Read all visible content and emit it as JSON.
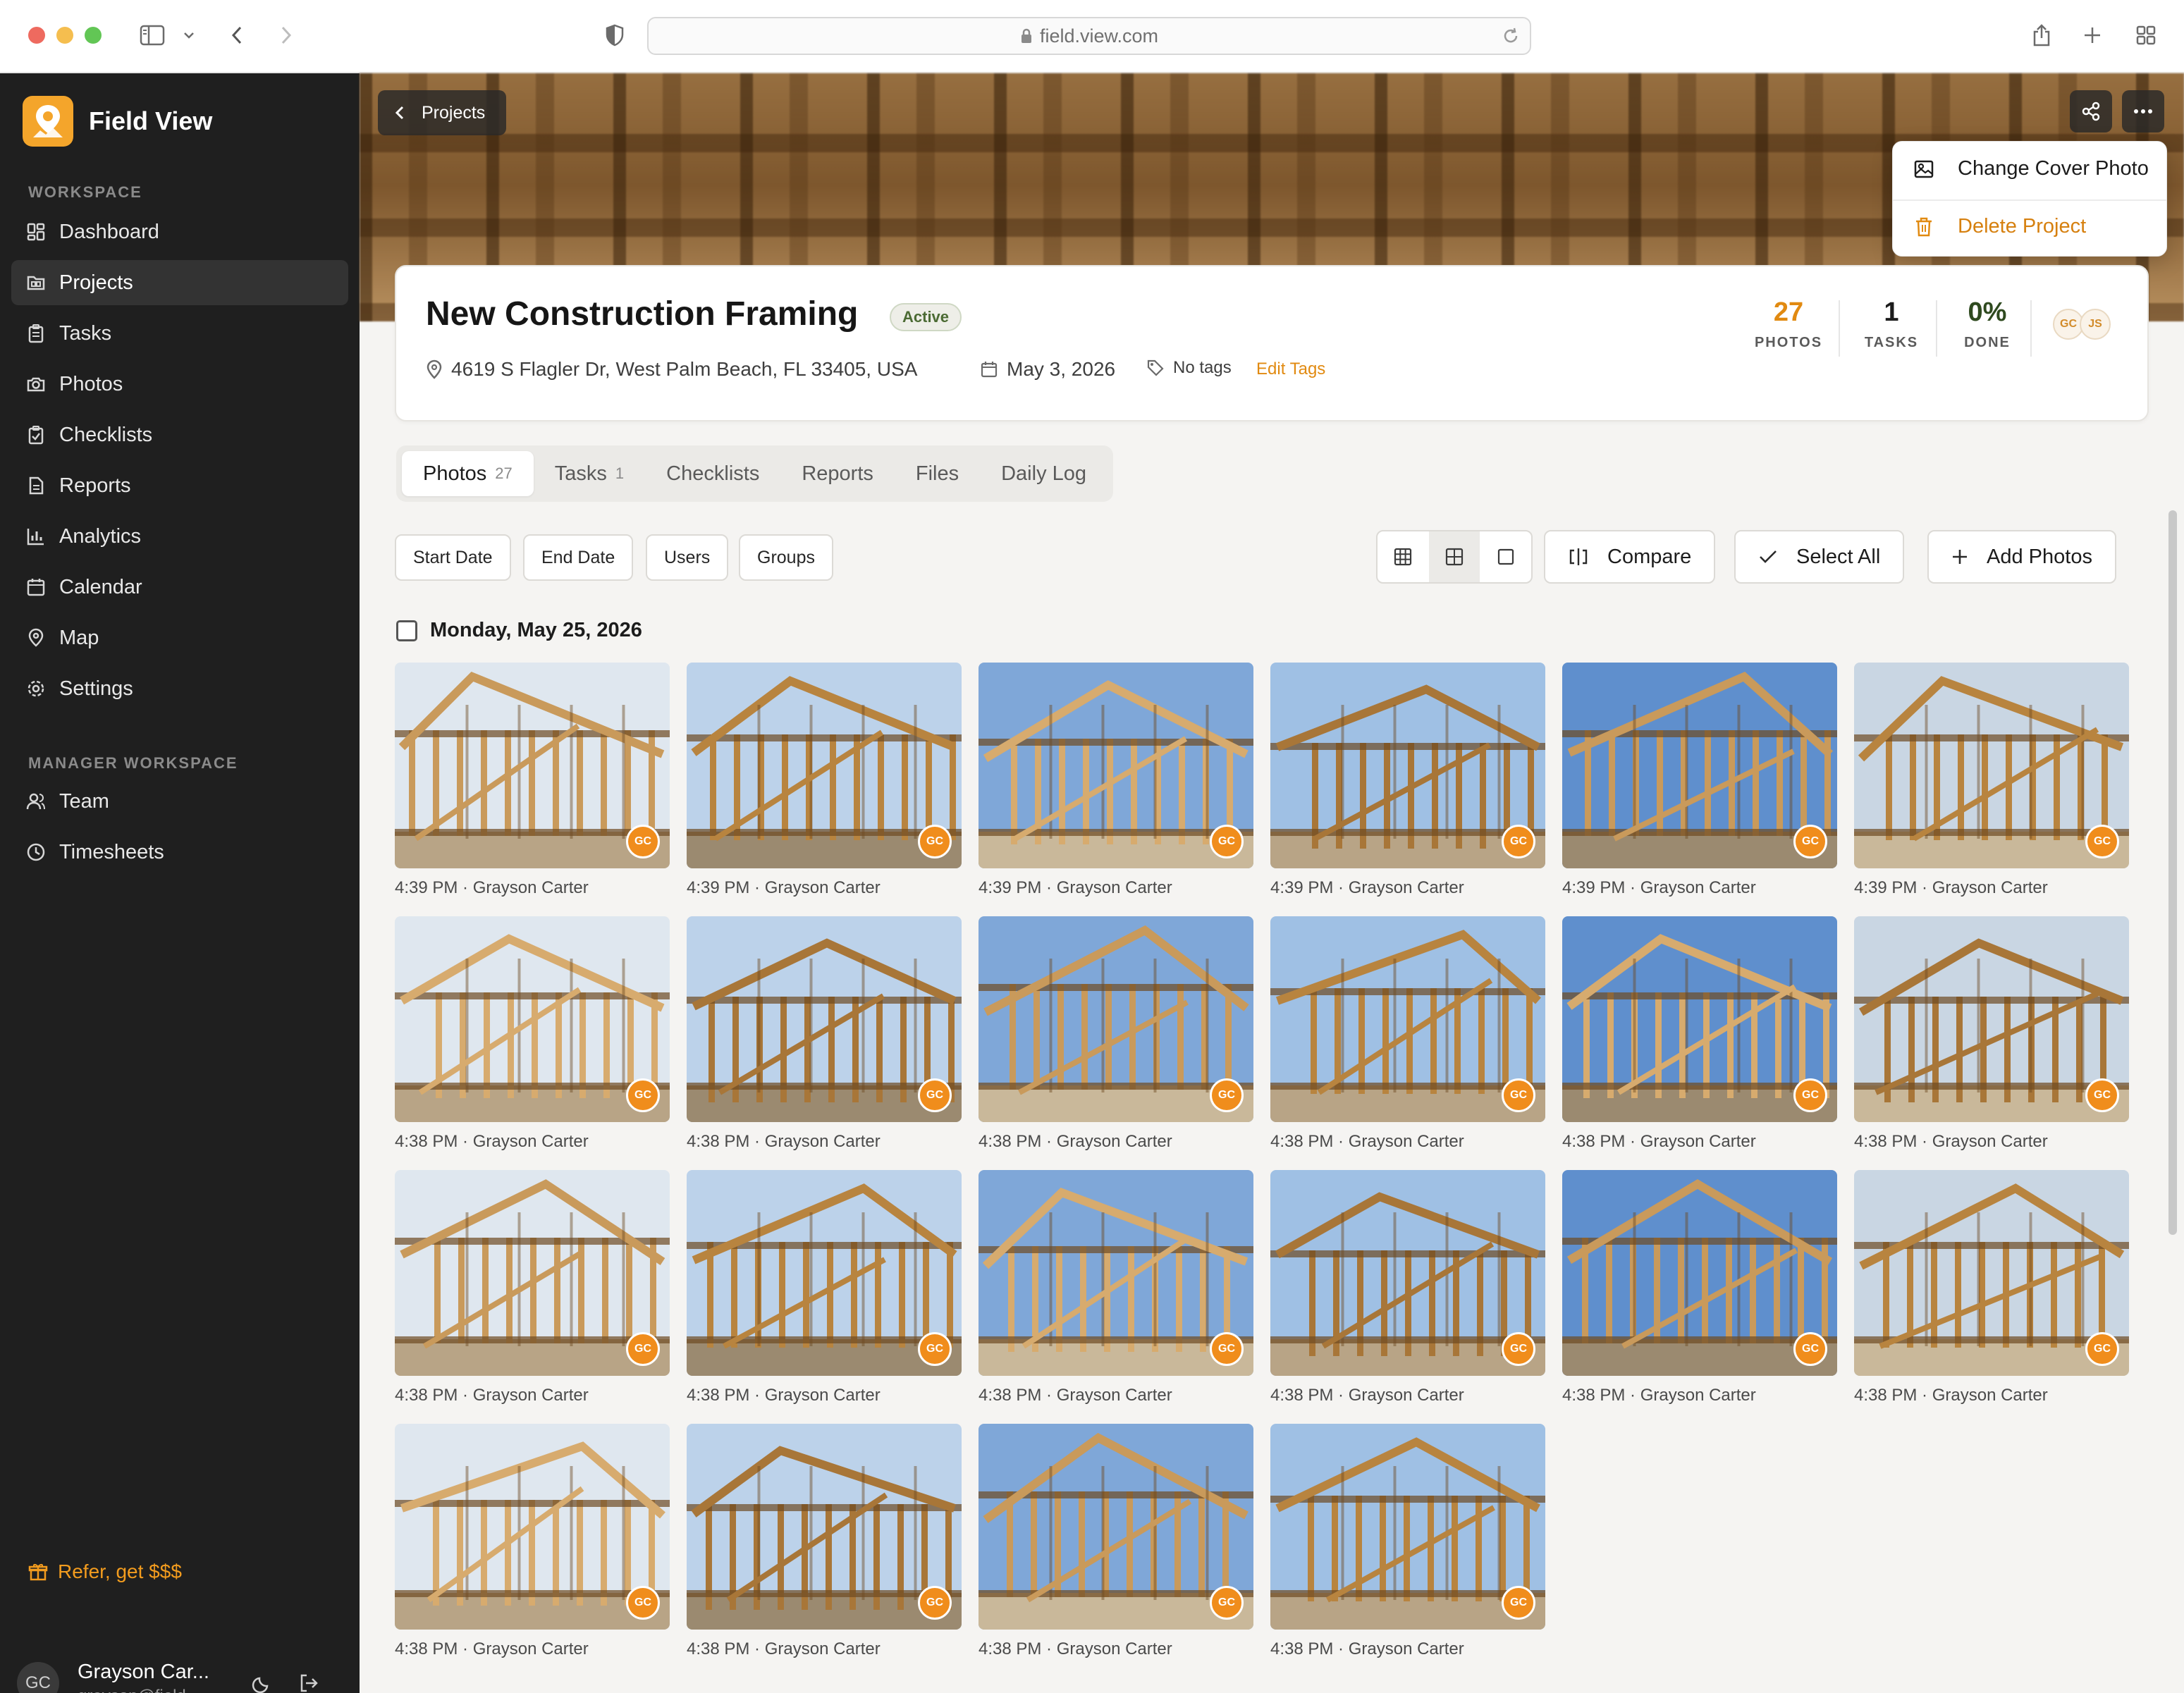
{
  "browser": {
    "url": "field.view.com"
  },
  "sidebar": {
    "app_name": "Field View",
    "workspace_label": "WORKSPACE",
    "items": [
      {
        "label": "Dashboard",
        "icon": "dashboard-icon"
      },
      {
        "label": "Projects",
        "icon": "folder-icon",
        "active": true
      },
      {
        "label": "Tasks",
        "icon": "clipboard-icon"
      },
      {
        "label": "Photos",
        "icon": "camera-icon"
      },
      {
        "label": "Checklists",
        "icon": "checklist-icon"
      },
      {
        "label": "Reports",
        "icon": "report-icon"
      },
      {
        "label": "Analytics",
        "icon": "bar-chart-icon"
      },
      {
        "label": "Calendar",
        "icon": "calendar-icon"
      },
      {
        "label": "Map",
        "icon": "map-pin-icon"
      },
      {
        "label": "Settings",
        "icon": "gear-icon"
      }
    ],
    "manager_label": "MANAGER WORKSPACE",
    "manager_items": [
      {
        "label": "Team",
        "icon": "team-icon"
      },
      {
        "label": "Timesheets",
        "icon": "clock-icon"
      }
    ],
    "refer_label": "Refer, get $$$",
    "user": {
      "initials": "GC",
      "name": "Grayson Car...",
      "email": "grayson@field-..."
    }
  },
  "cover": {
    "back_label": "Projects"
  },
  "menu": {
    "change_cover": "Change Cover Photo",
    "delete_project": "Delete Project"
  },
  "project": {
    "title": "New Construction Framing",
    "status": "Active",
    "address": "4619 S Flagler Dr, West Palm Beach, FL 33405, USA",
    "date": "May 3, 2026",
    "tags": "No tags",
    "edit_tags": "Edit Tags",
    "stats": [
      {
        "value": "27",
        "label": "PHOTOS",
        "color": "#e18a11"
      },
      {
        "value": "1",
        "label": "TASKS",
        "color": "#1c1c1c"
      },
      {
        "value": "0%",
        "label": "DONE",
        "color": "#2f4a1f"
      }
    ],
    "members": [
      "GC",
      "JS"
    ]
  },
  "tabs": [
    {
      "label": "Photos",
      "count": "27",
      "active": true
    },
    {
      "label": "Tasks",
      "count": "1"
    },
    {
      "label": "Checklists",
      "count": ""
    },
    {
      "label": "Reports",
      "count": ""
    },
    {
      "label": "Files",
      "count": ""
    },
    {
      "label": "Daily Log",
      "count": ""
    }
  ],
  "filters": [
    "Start Date",
    "End Date",
    "Users",
    "Groups"
  ],
  "actions": {
    "compare": "Compare",
    "select_all": "Select All",
    "add_photos": "Add Photos"
  },
  "date_header": "Monday, May 25, 2026",
  "photos": [
    {
      "caption": "4:39 PM · Grayson Carter",
      "badge": "GC"
    },
    {
      "caption": "4:39 PM · Grayson Carter",
      "badge": "GC"
    },
    {
      "caption": "4:39 PM · Grayson Carter",
      "badge": "GC"
    },
    {
      "caption": "4:39 PM · Grayson Carter",
      "badge": "GC"
    },
    {
      "caption": "4:39 PM · Grayson Carter",
      "badge": "GC"
    },
    {
      "caption": "4:39 PM · Grayson Carter",
      "badge": "GC"
    },
    {
      "caption": "4:38 PM · Grayson Carter",
      "badge": "GC"
    },
    {
      "caption": "4:38 PM · Grayson Carter",
      "badge": "GC"
    },
    {
      "caption": "4:38 PM · Grayson Carter",
      "badge": "GC"
    },
    {
      "caption": "4:38 PM · Grayson Carter",
      "badge": "GC"
    },
    {
      "caption": "4:38 PM · Grayson Carter",
      "badge": "GC"
    },
    {
      "caption": "4:38 PM · Grayson Carter",
      "badge": "GC"
    },
    {
      "caption": "4:38 PM · Grayson Carter",
      "badge": "GC"
    },
    {
      "caption": "4:38 PM · Grayson Carter",
      "badge": "GC"
    },
    {
      "caption": "4:38 PM · Grayson Carter",
      "badge": "GC"
    },
    {
      "caption": "4:38 PM · Grayson Carter",
      "badge": "GC"
    },
    {
      "caption": "4:38 PM · Grayson Carter",
      "badge": "GC"
    },
    {
      "caption": "4:38 PM · Grayson Carter",
      "badge": "GC"
    },
    {
      "caption": "4:38 PM · Grayson Carter",
      "badge": "GC"
    },
    {
      "caption": "4:38 PM · Grayson Carter",
      "badge": "GC"
    },
    {
      "caption": "4:38 PM · Grayson Carter",
      "badge": "GC"
    },
    {
      "caption": "4:38 PM · Grayson Carter",
      "badge": "GC"
    }
  ],
  "colors": {
    "accent": "#f08d1c",
    "sidebar_bg": "#1f1f1f",
    "page_bg": "#f5f4f2"
  }
}
